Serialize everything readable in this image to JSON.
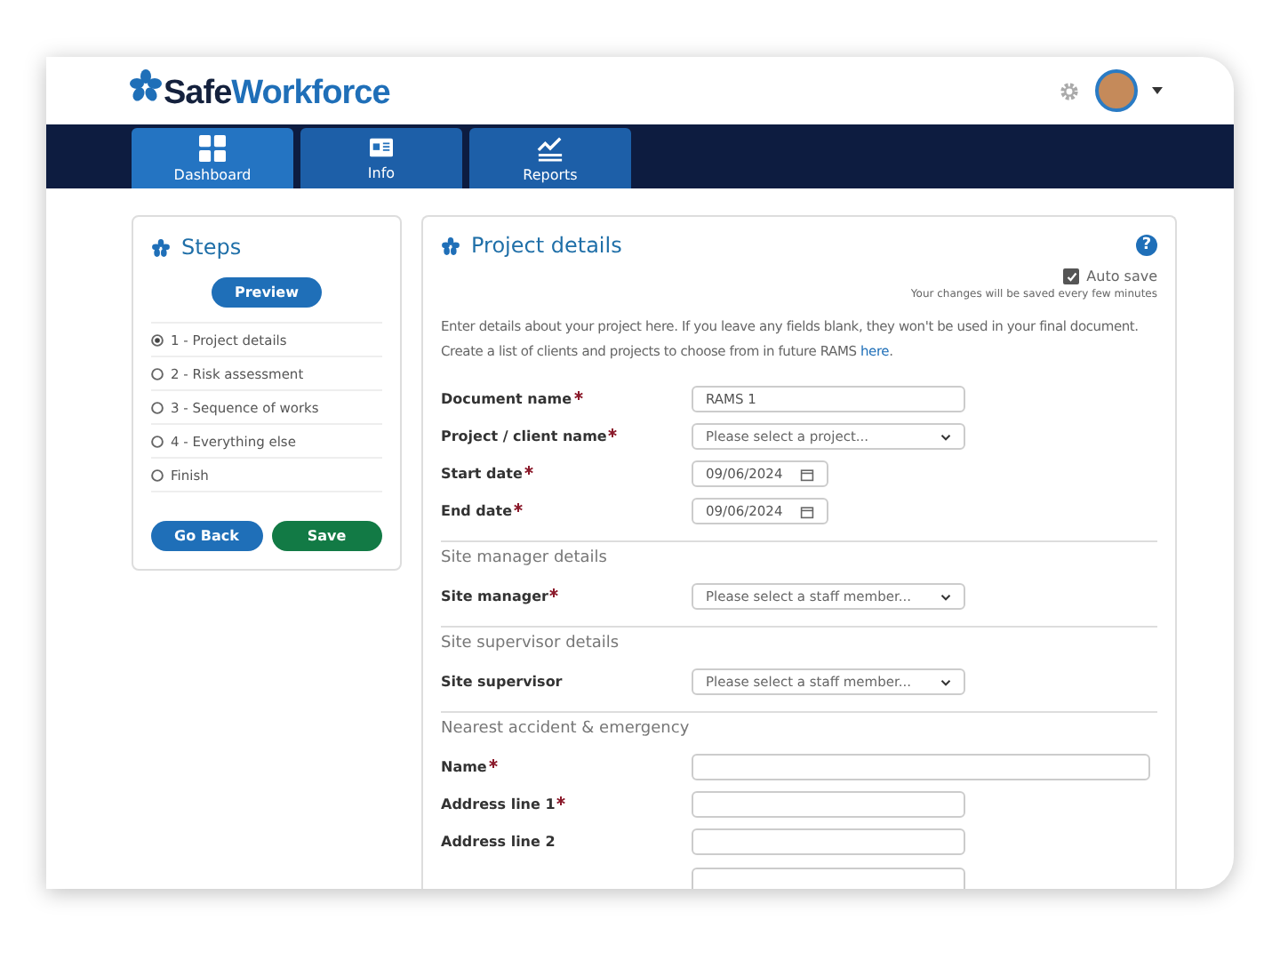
{
  "header": {
    "logo_prefix": "Safe",
    "logo_suffix": "Workforce"
  },
  "nav": [
    {
      "label": "Dashboard",
      "selected": true
    },
    {
      "label": "Info",
      "selected": false
    },
    {
      "label": "Reports",
      "selected": false
    }
  ],
  "steps": {
    "title": "Steps",
    "preview": "Preview",
    "items": [
      {
        "label": "1 - Project details",
        "selected": true
      },
      {
        "label": "2 - Risk assessment",
        "selected": false
      },
      {
        "label": "3 - Sequence of works",
        "selected": false
      },
      {
        "label": "4 - Everything else",
        "selected": false
      },
      {
        "label": "Finish",
        "selected": false
      }
    ],
    "buttons": [
      {
        "label": "Go Back",
        "kind": "primary"
      },
      {
        "label": "Save",
        "kind": "success"
      }
    ]
  },
  "details": {
    "title": "Project details",
    "help": "?",
    "autosave": {
      "label": "Auto save",
      "checked": true,
      "note": "Your changes will be saved every few minutes"
    },
    "intro": "Enter details about your project here. If you leave any fields blank, they won't be used in your final document.",
    "intro2": "Create a list of clients and projects to choose from in future RAMS",
    "intro2_link": "here",
    "intro2_end": ".",
    "rows": [
      {
        "kind": "text",
        "label": "Document name",
        "required": true,
        "value": "RAMS 1",
        "wide": false
      },
      {
        "kind": "select",
        "label": "Project / client name",
        "required": true,
        "placeholder": "Please select a project..."
      },
      {
        "kind": "date",
        "label": "Start date",
        "required": true,
        "value": "09/06/2024"
      },
      {
        "kind": "date",
        "label": "End date",
        "required": true,
        "value": "09/06/2024"
      },
      {
        "kind": "section",
        "title": "Site manager details"
      },
      {
        "kind": "select",
        "label": "Site manager",
        "required": true,
        "placeholder": "Please select a staff member..."
      },
      {
        "kind": "section",
        "title": "Site supervisor details"
      },
      {
        "kind": "select",
        "label": "Site supervisor",
        "required": false,
        "placeholder": "Please select a staff member..."
      },
      {
        "kind": "section",
        "title": "Nearest accident & emergency"
      },
      {
        "kind": "text",
        "label": "Name",
        "required": true,
        "value": "",
        "wide": true
      },
      {
        "kind": "text",
        "label": "Address line 1",
        "required": true,
        "value": "",
        "wide": false
      },
      {
        "kind": "text",
        "label": "Address line 2",
        "required": false,
        "value": "",
        "wide": false
      }
    ]
  }
}
